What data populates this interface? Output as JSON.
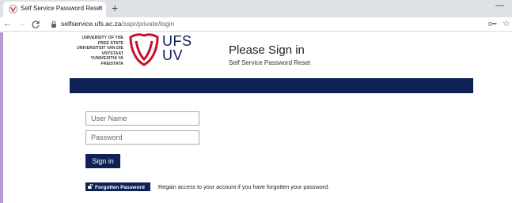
{
  "browser": {
    "tab": {
      "title": "Self Service Password Reset",
      "close_glyph": "×",
      "favicon": "ufs-favicon-icon"
    },
    "new_tab_glyph": "+",
    "minimize_glyph": "—",
    "nav": {
      "back": "←",
      "forward": "→",
      "reload": "C"
    },
    "url": {
      "host": "selfservice.ufs.ac.za",
      "path": "/sspr/private/login"
    },
    "icons": {
      "lock": "lock-icon",
      "key": "key-icon",
      "star": "star-icon"
    },
    "key_glyph": "o━",
    "star_glyph": "☆"
  },
  "header": {
    "university_lines": [
      "UNIVERSITY OF THE",
      "FREE STATE",
      "UNIVERSITEIT VAN DIE",
      "VRYSTAAT",
      "YUNIVESITHI YA",
      "FREISTATA"
    ],
    "logo_top": "UFS",
    "logo_bottom": "UV",
    "title": "Please Sign in",
    "subtitle": "Self Service Password Reset"
  },
  "form": {
    "username_placeholder": "User Name",
    "password_placeholder": "Password",
    "signin_label": "Sign in",
    "forgot_label": "Forgotten Password",
    "forgot_description": "Regain access to your account if you have forgotten your password."
  },
  "colors": {
    "brand_navy": "#0e2155",
    "logo_red": "#c8102e",
    "desktop_purple": "#b39ad3"
  }
}
